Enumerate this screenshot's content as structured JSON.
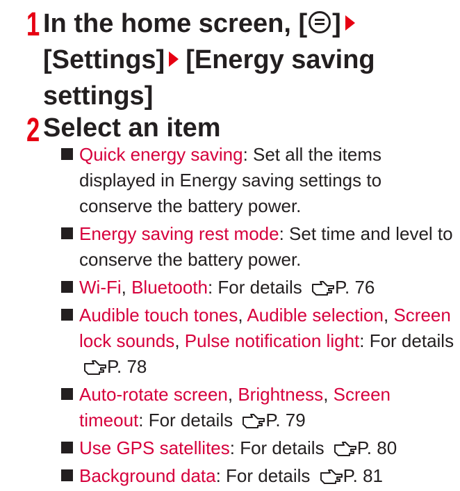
{
  "step1": {
    "number": "1",
    "line1_prefix": "In the home screen, [",
    "line1_suffix": "]",
    "settings": "[Settings]",
    "energy": "[Energy saving",
    "line3": "settings]"
  },
  "step2": {
    "number": "2",
    "heading": "Select an item"
  },
  "items": {
    "i0": {
      "l0": "Quick energy saving",
      "t0": ": Set all the items displayed in Energy saving settings to conserve the battery power."
    },
    "i1": {
      "l0": "Energy saving rest mode",
      "t0": ": Set time and level to conserve the battery power."
    },
    "i2": {
      "l0": "Wi-Fi",
      "s0": ", ",
      "l1": "Bluetooth",
      "t0": ": For details ",
      "ref": "P. 76"
    },
    "i3": {
      "l0": "Audible touch tones",
      "s0": ", ",
      "l1": "Audible selection",
      "s1": ", ",
      "l2": "Screen lock sounds",
      "s2": ", ",
      "l3": "Pulse notification light",
      "t0": ": For details ",
      "ref": "P. 78"
    },
    "i4": {
      "l0": "Auto-rotate screen",
      "s0": ", ",
      "l1": "Brightness",
      "s1": ", ",
      "l2": "Screen timeout",
      "t0": ": For details ",
      "ref": "P. 79"
    },
    "i5": {
      "l0": "Use GPS satellites",
      "t0": ": For details ",
      "ref": "P. 80"
    },
    "i6": {
      "l0": "Background data",
      "t0": ": For details ",
      "ref": "P. 81"
    }
  },
  "icons": {
    "menu": "menu-key-icon",
    "arrow": "right-triangle-arrow-icon",
    "reference": "pointing-hand-reference-icon"
  },
  "colors": {
    "accent_red": "#e60012",
    "link_red": "#d6003c",
    "text": "#231f20"
  }
}
